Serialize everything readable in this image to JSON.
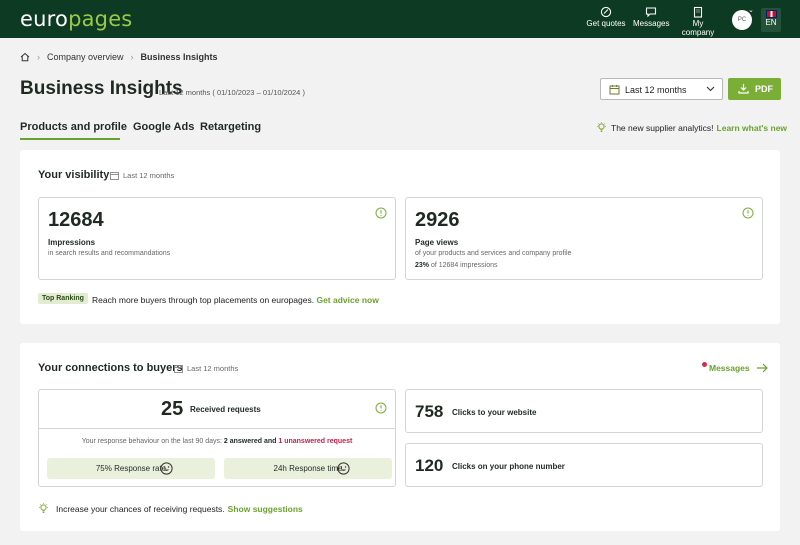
{
  "app": {
    "logo_text": "europages"
  },
  "topnav": {
    "get_quotes": "Get quotes",
    "messages": "Messages",
    "my_company": "My company",
    "avatar_initials": "PC",
    "language": "EN"
  },
  "breadcrumb": {
    "home_icon": "home-icon",
    "items": [
      "Company overview",
      "Business Insights"
    ]
  },
  "page": {
    "title": "Business Insights",
    "period": "Last 12 months ( 01/10/2023 – 01/10/2024 )",
    "date_select_value": "Last 12 months",
    "pdf_label": "PDF"
  },
  "tabs": [
    "Products and profile",
    "Google Ads",
    "Retargeting"
  ],
  "active_tab": "Products and profile",
  "analytics_note": {
    "text": "The new supplier analytics!",
    "link": "Learn what's new"
  },
  "visibility": {
    "title": "Your visibility",
    "period": "Last 12 months",
    "impressions": {
      "value": "12684",
      "label": "Impressions",
      "sub": "in search results and recommandations"
    },
    "page_views": {
      "value": "2926",
      "label": "Page views",
      "sub": "of your products and services and company profile",
      "share_pct": "23%",
      "share_rest": "of 12684 impressions"
    },
    "badge": "Top Ranking",
    "ranking_text": "Reach more buyers through top placements on europages.",
    "ranking_link": "Get advice now"
  },
  "connections": {
    "title": "Your connections to buyers",
    "period": "Last 12 months",
    "messages_link": "Messages",
    "requests_value": "25",
    "requests_label": "Received requests",
    "behaviour_prefix": "Your response behaviour on the last 90 days:",
    "answered": "2 answered and",
    "unanswered": "1 unanswered request",
    "response_rate": "75% Response rate",
    "response_time": "24h Response time",
    "website_clicks_value": "758",
    "website_clicks_label": "Clicks to your website",
    "phone_clicks_value": "120",
    "phone_clicks_label": "Clicks on your phone number",
    "suggest_text": "Increase your chances of receiving requests.",
    "suggest_link": "Show suggestions"
  },
  "colors": {
    "header_bg": "#0d3a22",
    "accent_green": "#6aa22e",
    "pdf_button": "#7aae36",
    "alert_red": "#c0204a"
  }
}
